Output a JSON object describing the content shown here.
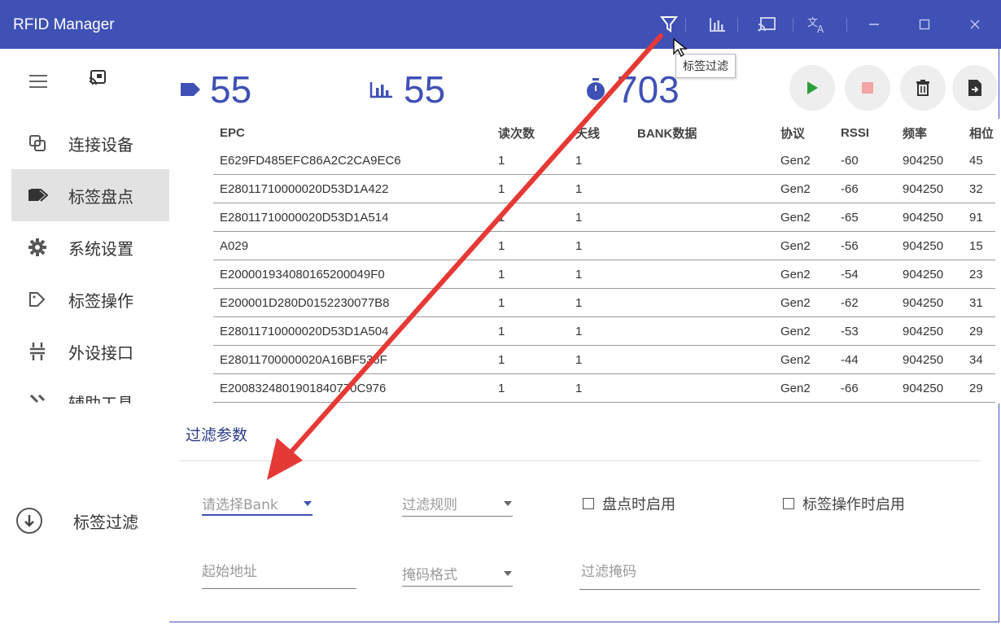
{
  "titlebar": {
    "title": "RFID Manager",
    "icons": [
      "filter-icon",
      "chart-icon",
      "cast-icon",
      "translate-icon",
      "minimize-icon",
      "maximize-icon",
      "close-icon"
    ]
  },
  "tooltip": "标签过滤",
  "sidebar": {
    "items": [
      {
        "label": "连接设备",
        "icon": "link-icon"
      },
      {
        "label": "标签盘点",
        "icon": "tag-icon",
        "active": true
      },
      {
        "label": "系统设置",
        "icon": "gear-icon"
      },
      {
        "label": "标签操作",
        "icon": "tag-edit-icon"
      },
      {
        "label": "外设接口",
        "icon": "usb-icon"
      },
      {
        "label": "辅助工具",
        "icon": "tools-icon"
      }
    ],
    "filter_label": "标签过滤"
  },
  "stats": {
    "tag_count": "55",
    "read_count": "55",
    "timer": "703"
  },
  "table": {
    "headers": [
      "EPC",
      "读次数",
      "天线",
      "BANK数据",
      "协议",
      "RSSI",
      "频率",
      "相位"
    ],
    "rows": [
      [
        "E629FD485EFC86A2C2CA9EC6",
        "1",
        "1",
        "",
        "Gen2",
        "-60",
        "904250",
        "45"
      ],
      [
        "E28011710000020D53D1A422",
        "1",
        "1",
        "",
        "Gen2",
        "-66",
        "904250",
        "32"
      ],
      [
        "E28011710000020D53D1A514",
        "1",
        "1",
        "",
        "Gen2",
        "-65",
        "904250",
        "91"
      ],
      [
        "A029",
        "1",
        "1",
        "",
        "Gen2",
        "-56",
        "904250",
        "15"
      ],
      [
        "E20000193408016520004​9F0",
        "1",
        "1",
        "",
        "Gen2",
        "-54",
        "904250",
        "23"
      ],
      [
        "E200001D280D01522300​77B8",
        "1",
        "1",
        "",
        "Gen2",
        "-62",
        "904250",
        "31"
      ],
      [
        "E28011710000020D53D1A504",
        "1",
        "1",
        "",
        "Gen2",
        "-53",
        "904250",
        "29"
      ],
      [
        "E28011700000020A16BF536F",
        "1",
        "1",
        "",
        "Gen2",
        "-44",
        "904250",
        "34"
      ],
      [
        "E20083248​01901840770C976",
        "1",
        "1",
        "",
        "Gen2",
        "-66",
        "904250",
        "29"
      ]
    ]
  },
  "filter_panel": {
    "title": "过滤参数",
    "bank_placeholder": "请选择Bank",
    "rule_placeholder": "过滤规则",
    "inventory_enable": "盘点时启用",
    "tagop_enable": "标签操作时启用",
    "start_addr_placeholder": "起始地址",
    "mask_format_placeholder": "掩码格式",
    "mask_placeholder": "过滤掩码"
  },
  "colors": {
    "brand": "#3f51b5",
    "annotation_arrow": "#e53935",
    "play": "#2e9e3a",
    "stop": "#f3a4a4"
  }
}
